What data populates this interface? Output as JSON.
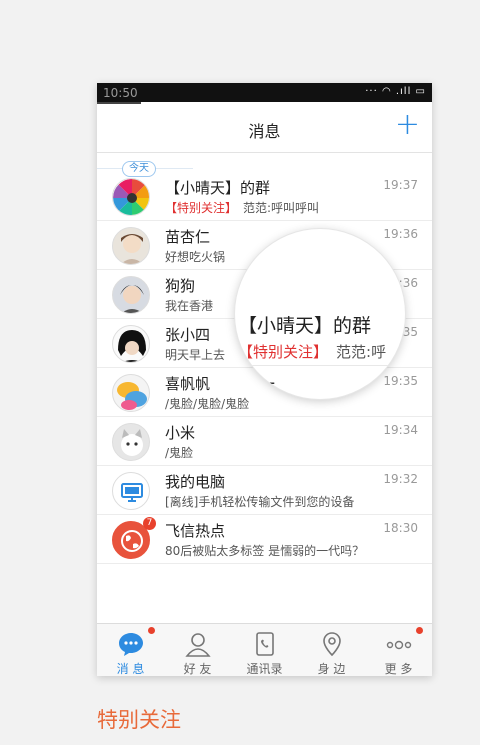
{
  "status_bar": {
    "time": "10:50",
    "indicators": "··· ◠ .ıll ▭"
  },
  "header": {
    "title": "消息",
    "add_label": "+"
  },
  "today_label": "今天",
  "messages": [
    {
      "name": "【小晴天】的群",
      "tag": "【特别关注】",
      "preview": "范范:呼叫呼叫",
      "time": "19:37"
    },
    {
      "name": "苗杏仁",
      "preview": "好想吃火锅",
      "time": "19:36"
    },
    {
      "name": "狗狗",
      "preview": "我在香港",
      "time": "19:36"
    },
    {
      "name": "张小四",
      "preview": "明天早上去",
      "time": "19:35"
    },
    {
      "name": "喜帆帆",
      "preview": "/鬼脸/鬼脸/鬼脸",
      "time": "19:35"
    },
    {
      "name": "小米",
      "preview": "/鬼脸",
      "time": "19:34"
    },
    {
      "name": "我的电脑",
      "preview": "[离线]手机轻松传输文件到您的设备",
      "time": "19:32"
    },
    {
      "name": "飞信热点",
      "preview": "80后被贴太多标签 是懦弱的一代吗？",
      "time": "18:30",
      "badge": "7"
    }
  ],
  "magnifier": {
    "name": "【小晴天】的群",
    "tag": "【特别关注】",
    "preview": "范范:呼",
    "next_name": "杏仁"
  },
  "tabs": [
    {
      "label": "消 息"
    },
    {
      "label": "好 友"
    },
    {
      "label": "通讯录"
    },
    {
      "label": "身 边"
    },
    {
      "label": "更 多"
    }
  ],
  "caption": "特别关注",
  "colors": {
    "accent": "#2d8be0",
    "highlight": "#e03030",
    "badge": "#e8412c",
    "caption": "#e86a3a"
  }
}
